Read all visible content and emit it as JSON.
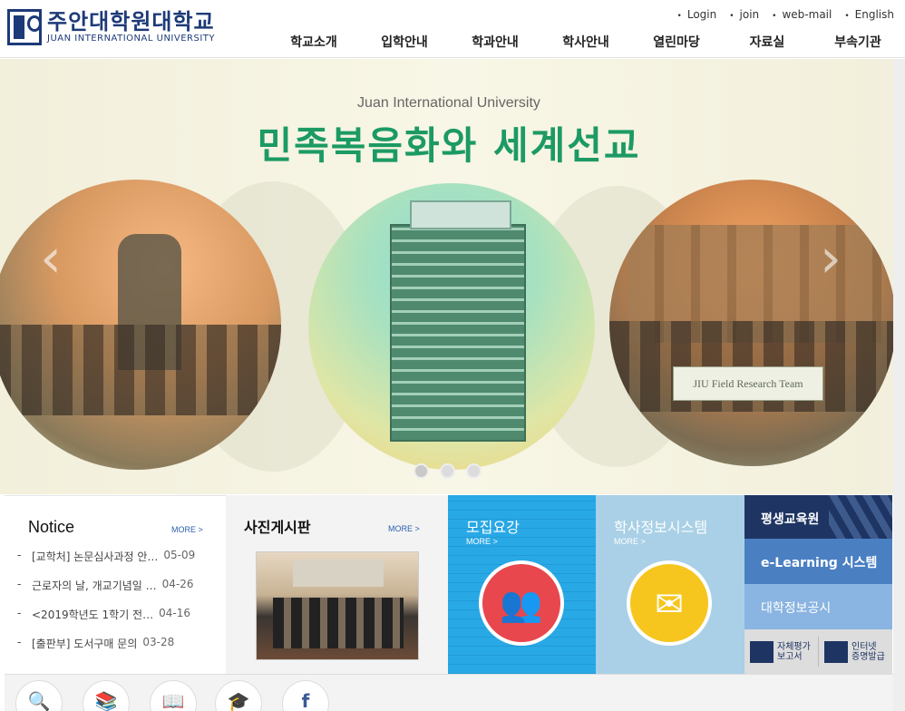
{
  "header": {
    "logo_ko": "주안대학원대학교",
    "logo_en": "JUAN INTERNATIONAL UNIVERSITY",
    "util": [
      "Login",
      "join",
      "web-mail",
      "English"
    ],
    "gnb": [
      "학교소개",
      "입학안내",
      "학과안내",
      "학사안내",
      "열린마당",
      "자료실",
      "부속기관"
    ]
  },
  "hero": {
    "subtitle": "Juan International University",
    "title": "민족복음화와 세계선교",
    "banner_text": "JIU Field Research Team",
    "prev": "‹",
    "next": "›",
    "slide_count": 3,
    "active_slide": 1
  },
  "notice": {
    "title": "Notice",
    "more": "MORE >",
    "items": [
      {
        "text": "[교학처] 논문심사과정 안…",
        "date": "05-09"
      },
      {
        "text": "근로자의 날, 개교기념일 …",
        "date": "04-26"
      },
      {
        "text": "<2019학년도 1학기 전…",
        "date": "04-16"
      },
      {
        "text": "[출판부] 도서구매 문의",
        "date": "03-28"
      }
    ]
  },
  "photo": {
    "title": "사진게시판",
    "more": "MORE >"
  },
  "recruit": {
    "title": "모집요강",
    "more": "MORE >",
    "icon": "people-icon"
  },
  "hsys": {
    "title": "학사정보시스템",
    "more": "MORE >",
    "icon": "message-icon"
  },
  "life": {
    "title": "평생교육원",
    "elearning": "e-Learning 시스템",
    "public": "대학정보공시",
    "self_eval": [
      "자체평가",
      "보고서"
    ],
    "cert": [
      "인터넷",
      "증명발급"
    ]
  },
  "quick": {
    "icons": [
      "search-chart-icon",
      "library-icon",
      "book-icon",
      "graduation-icon",
      "facebook-icon"
    ],
    "glyphs": [
      "🔍",
      "📚",
      "📖",
      "🎓",
      "f"
    ]
  }
}
